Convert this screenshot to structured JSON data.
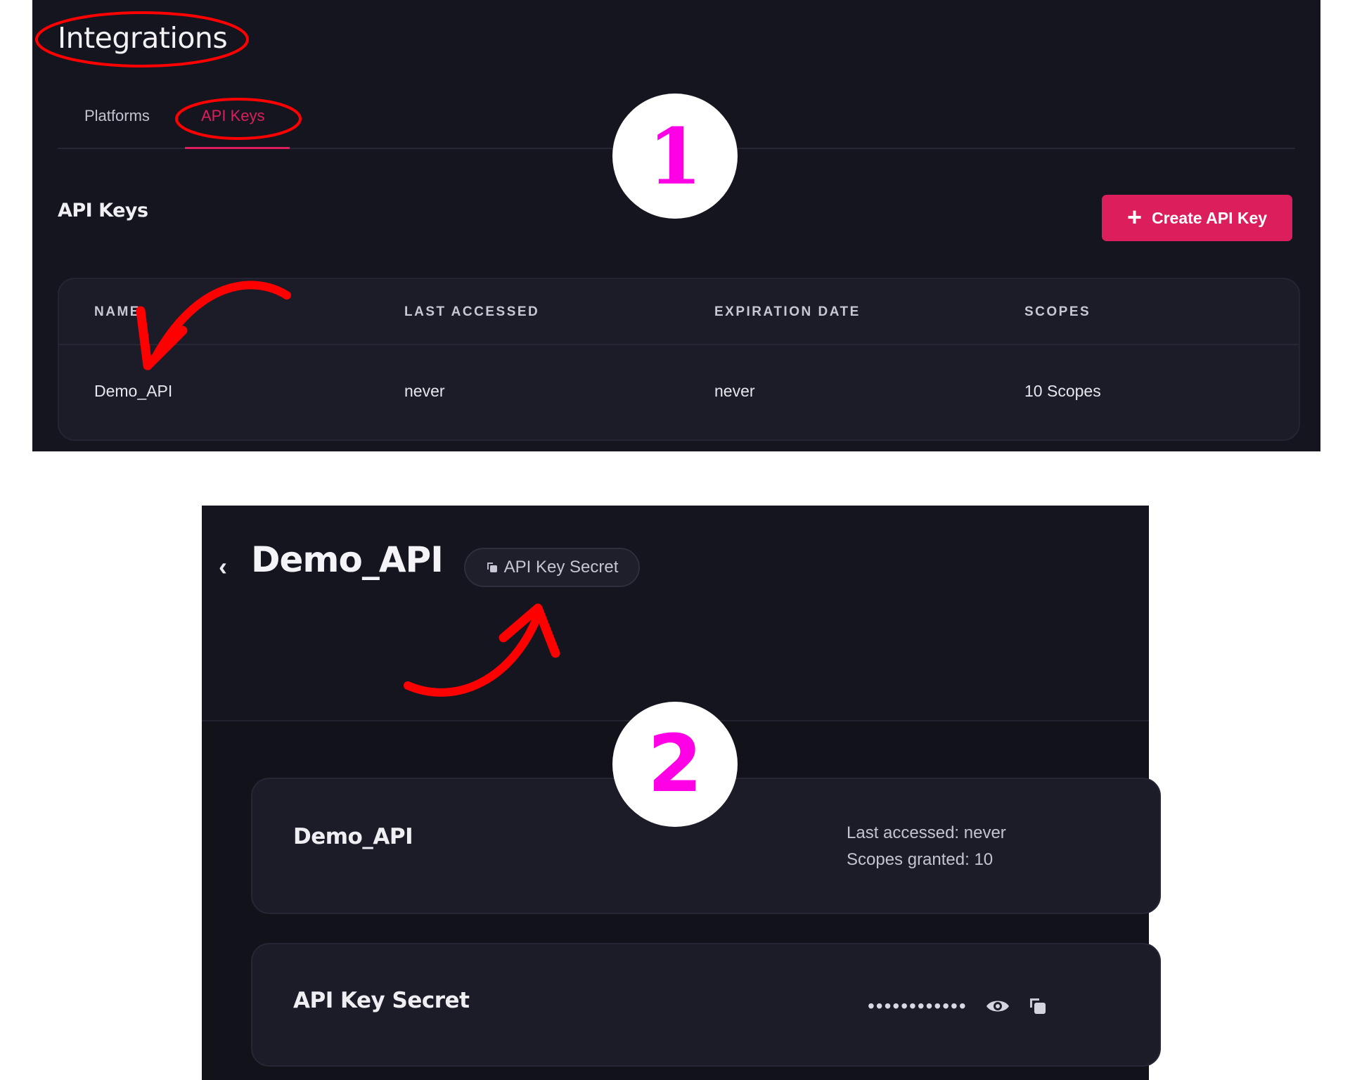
{
  "panel1": {
    "title": "Integrations",
    "tabs": [
      {
        "label": "Platforms",
        "active": false
      },
      {
        "label": "API Keys",
        "active": true
      }
    ],
    "section_title": "API Keys",
    "create_button": {
      "label": "Create API Key",
      "icon": "plus-icon"
    },
    "table": {
      "columns": [
        "NAME",
        "LAST ACCESSED",
        "EXPIRATION DATE",
        "SCOPES"
      ],
      "rows": [
        {
          "name": "Demo_API",
          "last_accessed": "never",
          "expiration_date": "never",
          "scopes": "10 Scopes"
        }
      ]
    }
  },
  "panel2": {
    "back_icon": "chevron-left-icon",
    "title": "Demo_API",
    "secret_pill": {
      "label": "API Key Secret",
      "icon": "copy-icon"
    },
    "details_card": {
      "title": "Demo_API",
      "last_accessed": "Last accessed: never",
      "scopes_granted": "Scopes granted: 10"
    },
    "secret_card": {
      "title": "API Key Secret",
      "masked_value": "••••••••••••",
      "reveal_icon": "eye-icon",
      "copy_icon": "copy-icon"
    }
  },
  "annotations": {
    "step1": "1",
    "step2": "2",
    "highlight_color": "#ff0000",
    "step_color": "#ff00e6"
  },
  "colors": {
    "background": "#15151f",
    "accent": "#dc1f5c",
    "card": "#1c1c28"
  }
}
